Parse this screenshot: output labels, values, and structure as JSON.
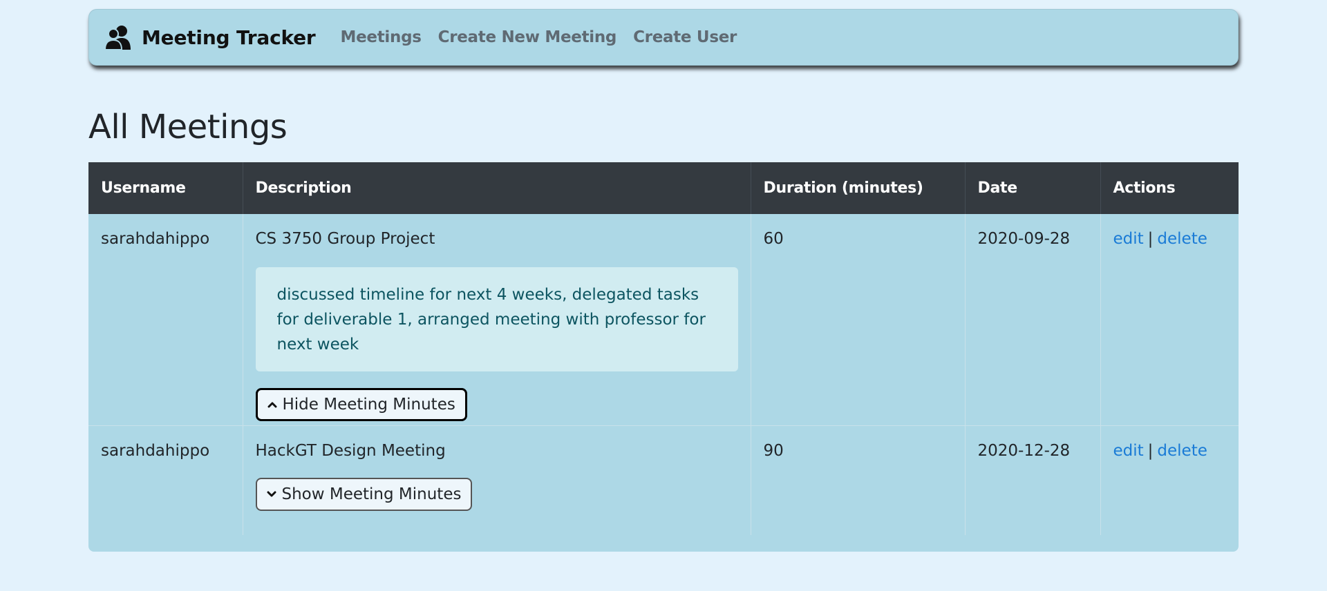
{
  "navbar": {
    "brand_icon": "users-icon",
    "brand": "Meeting Tracker",
    "links": [
      "Meetings",
      "Create New Meeting",
      "Create User"
    ]
  },
  "page": {
    "title": "All Meetings"
  },
  "table": {
    "headers": [
      "Username",
      "Description",
      "Duration (minutes)",
      "Date",
      "Actions"
    ],
    "rows": [
      {
        "username": "sarahdahippo",
        "description": "CS 3750 Group Project",
        "minutes": "discussed timeline for next 4 weeks, delegated tasks for deliverable 1, arranged meeting with professor for next week",
        "toggle_label": "Hide Meeting Minutes",
        "toggle_icon": "chevron-up-icon",
        "duration": "60",
        "date": "2020-09-28",
        "edit": "edit",
        "separator": "|",
        "delete": "delete"
      },
      {
        "username": "sarahdahippo",
        "description": "HackGT Design Meeting",
        "toggle_label": "Show Meeting Minutes",
        "toggle_icon": "chevron-down-icon",
        "duration": "90",
        "date": "2020-12-28",
        "edit": "edit",
        "separator": "|",
        "delete": "delete"
      }
    ]
  },
  "colors": {
    "page_bg": "#e3f2fc",
    "navbar_bg": "#add8e6",
    "table_header_bg": "#343a40",
    "minutes_bg": "#d1ecf1",
    "minutes_text": "#0c5460",
    "link": "#1a7bd6"
  }
}
